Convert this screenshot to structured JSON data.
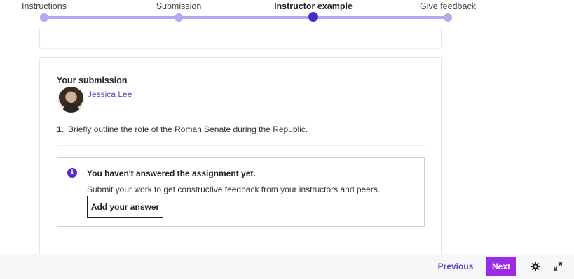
{
  "stepper": {
    "steps": [
      {
        "label": "Instructions"
      },
      {
        "label": "Submission"
      },
      {
        "label": "Instructor example"
      },
      {
        "label": "Give feedback"
      }
    ],
    "active_step": "Instructor example"
  },
  "submission": {
    "heading": "Your submission",
    "student_name": "Jessica Lee",
    "question_number": "1.",
    "question_text": "Briefly outline the role of the Roman Senate during the Republic."
  },
  "notice": {
    "icon": "info-icon",
    "icon_glyph": "i",
    "title": "You haven't answered the assignment yet.",
    "text": "Submit your work to get constructive feedback from your instructors and peers.",
    "button_label": "Add your answer"
  },
  "footer": {
    "previous_label": "Previous",
    "next_label": "Next",
    "icons": [
      "gear-icon",
      "expand-icon"
    ]
  },
  "colors": {
    "accent": "#9c2be6",
    "link": "#6a3fc1",
    "stepper_track": "#b9a8ea",
    "stepper_active": "#4b2bc4"
  }
}
